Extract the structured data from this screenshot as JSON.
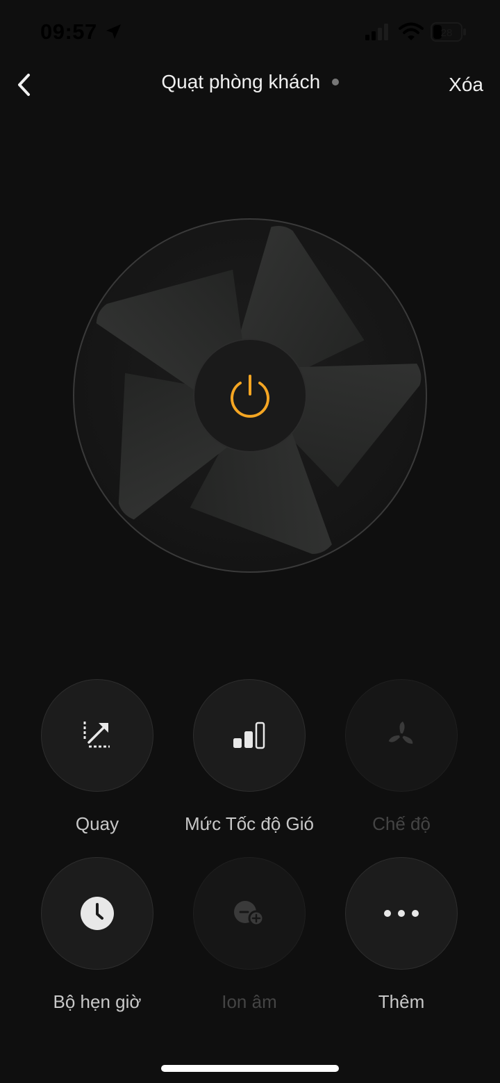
{
  "status_bar": {
    "time": "09:57",
    "icons": [
      "location-arrow-icon",
      "cellular-signal-icon",
      "wifi-icon",
      "battery-icon"
    ],
    "battery_level": "28"
  },
  "header": {
    "back_icon": "chevron-left-icon",
    "title": "Quạt phòng khách",
    "delete_label": "Xóa"
  },
  "fan": {
    "power_icon": "power-icon",
    "power_color": "#f5a623",
    "state": "off"
  },
  "controls": [
    {
      "label": "Quay",
      "icon": "oscillate-icon",
      "enabled": true
    },
    {
      "label": "Mức Tốc độ Gió",
      "icon": "wind-speed-icon",
      "enabled": true
    },
    {
      "label": "Chế độ",
      "icon": "fan-mode-icon",
      "enabled": false
    },
    {
      "label": "Bộ hẹn giờ",
      "icon": "clock-icon",
      "enabled": true
    },
    {
      "label": "Ion âm",
      "icon": "negative-ion-icon",
      "enabled": false
    },
    {
      "label": "Thêm",
      "icon": "more-dots-icon",
      "enabled": true
    }
  ],
  "colors": {
    "background": "#0f0f0f",
    "accent": "#f5a623",
    "button_bg": "#1c1c1c",
    "label_enabled": "#c8c8c8",
    "label_disabled": "#444444"
  }
}
